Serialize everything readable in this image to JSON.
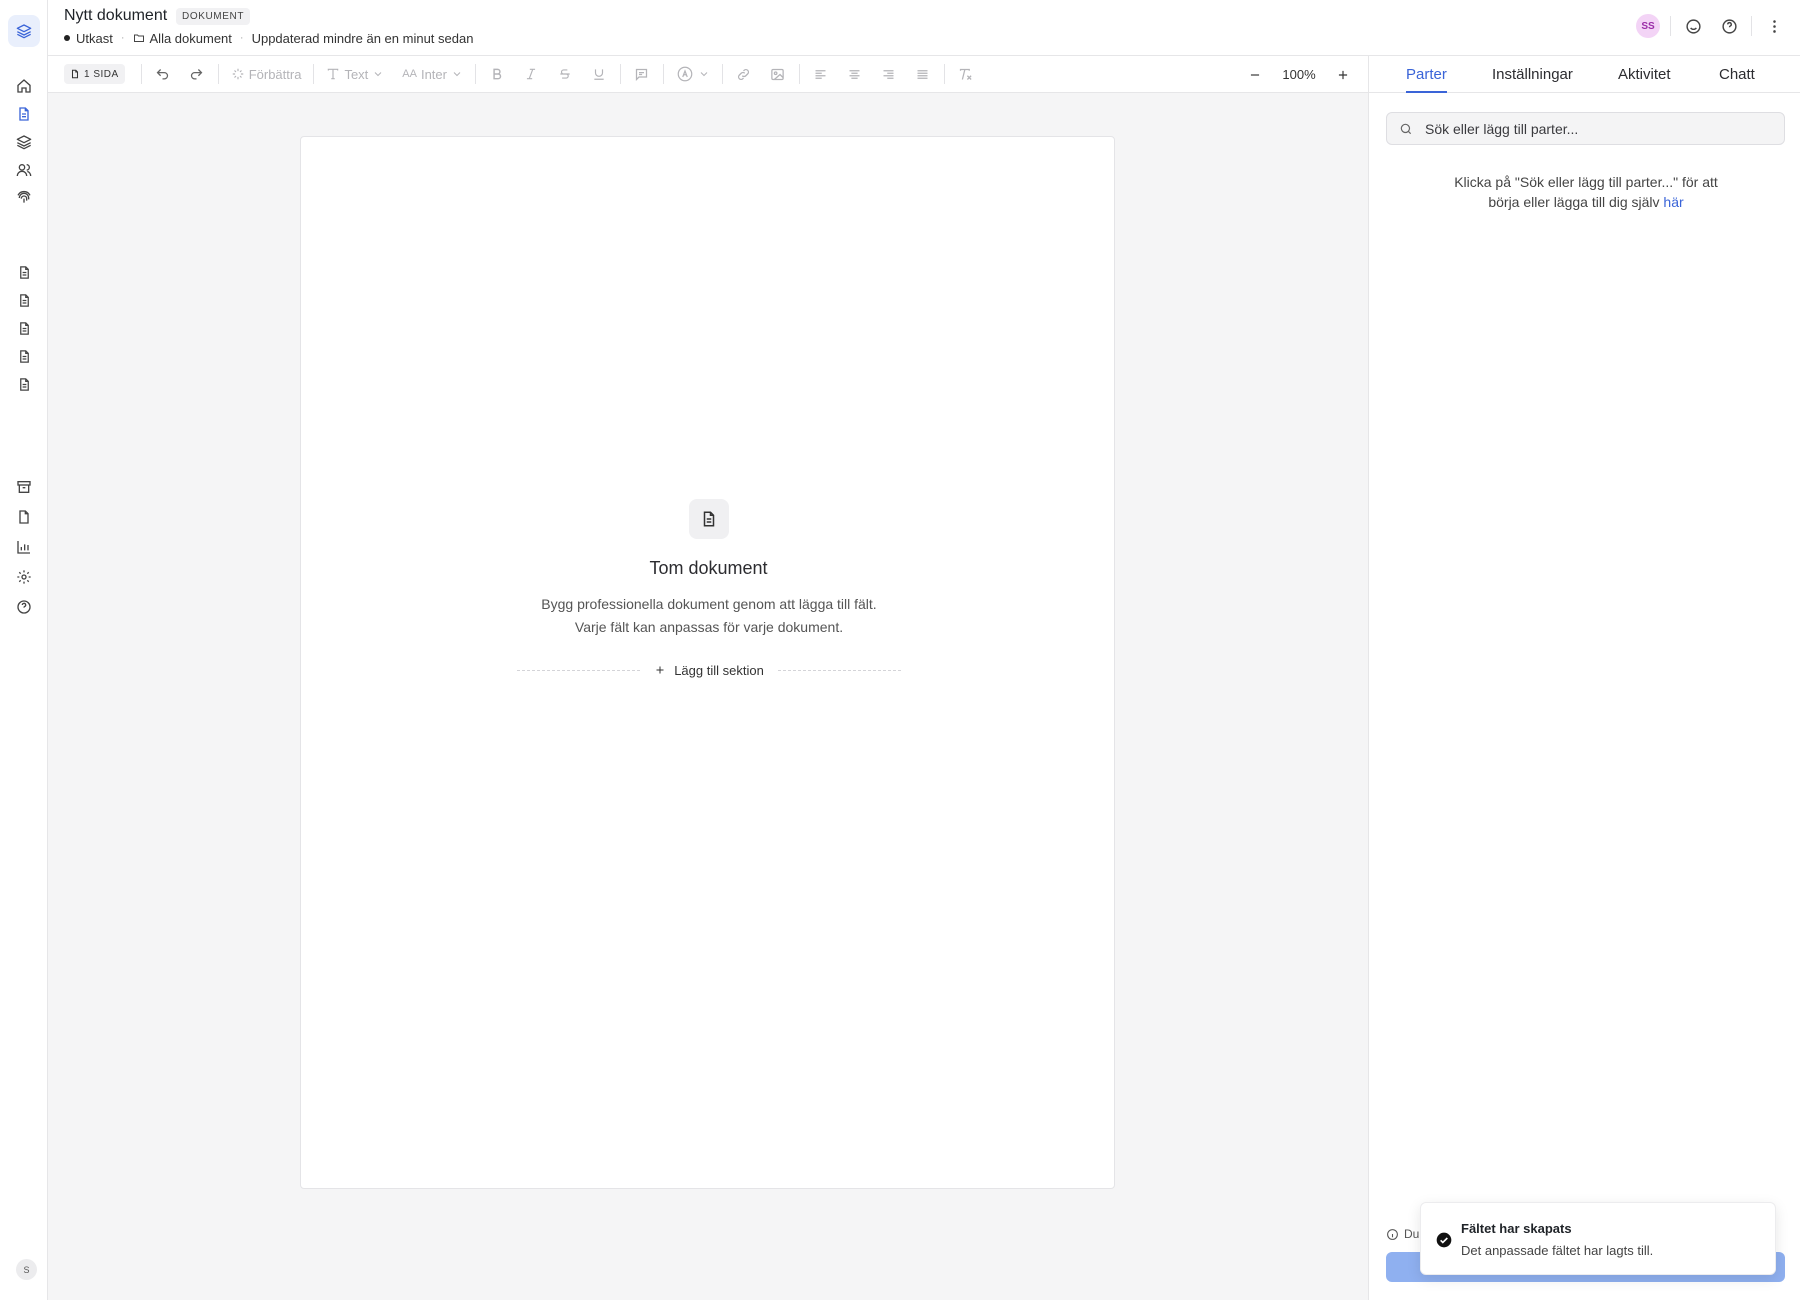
{
  "header": {
    "title": "Nytt dokument",
    "badge": "DOKUMENT",
    "status": "Utkast",
    "folder": "Alla dokument",
    "updated": "Uppdaterad mindre än en minut sedan",
    "avatar_initials": "SS"
  },
  "toolbar": {
    "pages_label": "1 SIDA",
    "improve_label": "Förbättra",
    "text_style_label": "Text",
    "font_label": "Inter",
    "zoom_level": "100%"
  },
  "document": {
    "empty_title": "Tom dokument",
    "empty_description": "Bygg professionella dokument genom att lägga till fält. Varje fält kan anpassas för varje dokument.",
    "add_section_label": "Lägg till sektion"
  },
  "panel": {
    "tabs": [
      {
        "label": "Parter",
        "active": true
      },
      {
        "label": "Inställningar",
        "active": false
      },
      {
        "label": "Aktivitet",
        "active": false
      },
      {
        "label": "Chatt",
        "active": false
      }
    ],
    "search_placeholder": "Sök eller lägg till parter...",
    "hint_text": "Klicka på \"Sök eller lägg till parter...\" för att börja eller lägga till dig själv",
    "hint_link": "här",
    "footer_text": "Du"
  },
  "sidebar": {
    "user_initial": "S"
  },
  "toast": {
    "title": "Fältet har skapats",
    "description": "Det anpassade fältet har lagts till."
  },
  "colors": {
    "accent": "#3a64d8",
    "avatar_bg": "#f3d4f6",
    "canvas_bg": "#f5f5f6"
  }
}
